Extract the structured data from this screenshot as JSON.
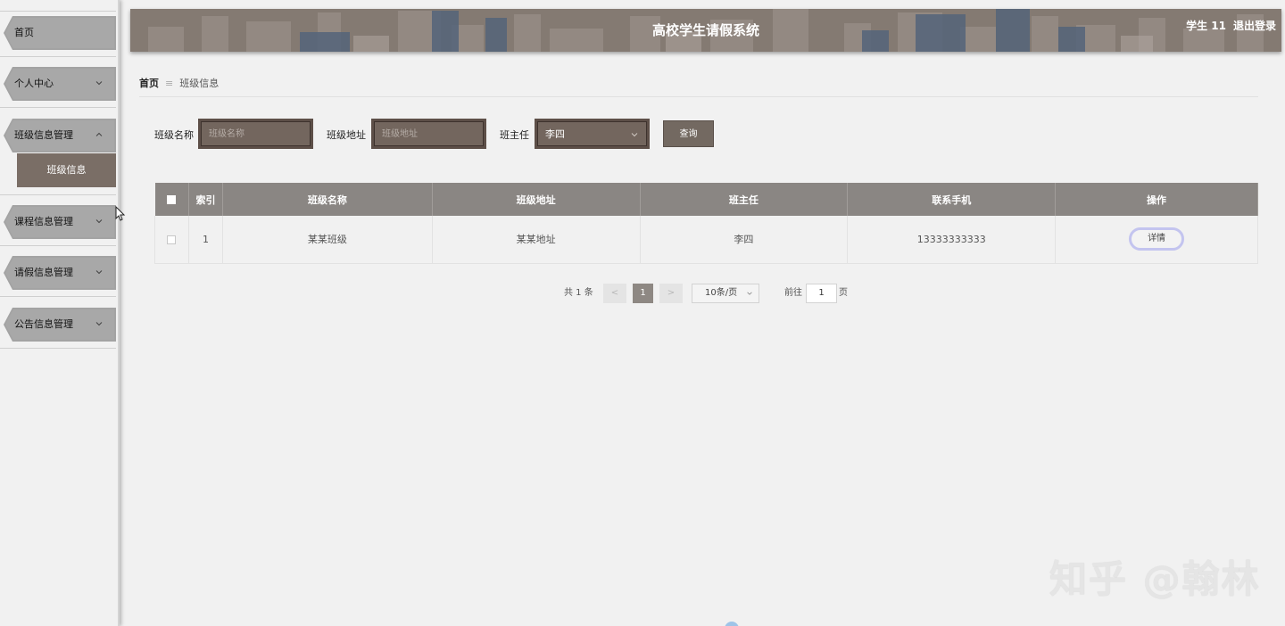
{
  "header": {
    "title": "高校学生请假系统",
    "user": "学生 11",
    "logout": "退出登录"
  },
  "sidebar": {
    "items": [
      {
        "label": "首页"
      },
      {
        "label": "个人中心"
      },
      {
        "label": "班级信息管理"
      },
      {
        "label": "课程信息管理"
      },
      {
        "label": "请假信息管理"
      },
      {
        "label": "公告信息管理"
      }
    ],
    "submenu": {
      "label": "班级信息"
    }
  },
  "breadcrumb": {
    "home": "首页",
    "separator": "≡",
    "current": "班级信息"
  },
  "search": {
    "class_name_label": "班级名称",
    "class_name_placeholder": "班级名称",
    "class_address_label": "班级地址",
    "class_address_placeholder": "班级地址",
    "head_teacher_label": "班主任",
    "head_teacher_value": "李四",
    "query_button": "查询"
  },
  "table": {
    "columns": [
      "索引",
      "班级名称",
      "班级地址",
      "班主任",
      "联系手机",
      "操作"
    ],
    "rows": [
      {
        "index": "1",
        "class_name": "某某班级",
        "class_address": "某某地址",
        "head_teacher": "李四",
        "phone": "13333333333",
        "action": "详情"
      }
    ]
  },
  "pagination": {
    "total": "共 1 条",
    "prev": "<",
    "current_page": "1",
    "next": ">",
    "page_size": "10条/页",
    "goto_label": "前往",
    "goto_value": "1",
    "page_suffix": "页"
  },
  "watermark": "知乎 @翰林",
  "colors": {
    "header_bg": "#847a72",
    "submenu_active": "#7a6e66",
    "input_border": "#5d4f48",
    "table_header": "#8a8683"
  }
}
